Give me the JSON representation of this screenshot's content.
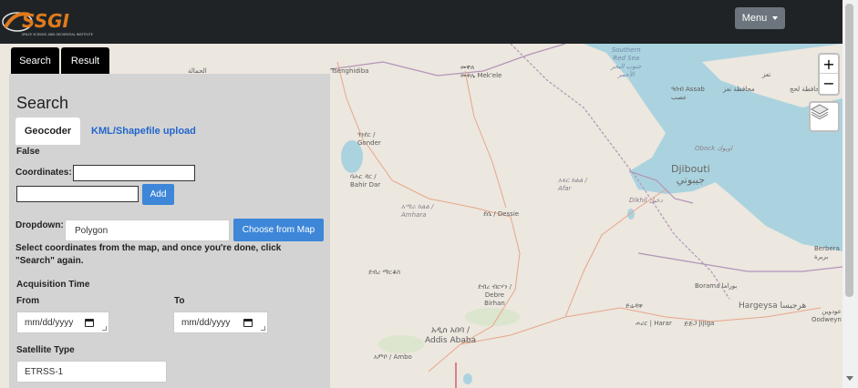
{
  "header": {
    "logo_text": "SSGI",
    "logo_tagline": "SPACE SCIENCE AND GEOSPATIAL INSTITUTE",
    "menu_label": "Menu"
  },
  "tabs": {
    "search": "Search",
    "result": "Result"
  },
  "panel": {
    "title": "Search",
    "subtabs": {
      "geocoder": "Geocoder",
      "kml": "KML/Shapefile upload"
    },
    "false_text": "False",
    "coordinates_label": "Coordinates:",
    "coordinates_value": "",
    "second_coordinate_value": "",
    "add_button": "Add",
    "dropdown_label": "Dropdown:",
    "dropdown_value": "Polygon",
    "choose_map_button": "Choose from Map",
    "hint_line1": "Select coordinates from the map, and once you're done, click",
    "hint_line2": "\"Search\" again.",
    "acquisition_label": "Acquisition Time",
    "from_label": "From",
    "to_label": "To",
    "from_placeholder": "mm/dd/yyyy",
    "to_placeholder": "mm/dd/yyyy",
    "satellite_label": "Satellite Type",
    "satellite_value": "ETRSS-1"
  },
  "map": {
    "zoom_in": "+",
    "zoom_out": "−",
    "labels": {
      "southern_red_sea": "Southern\nRed Sea\nجنوب البحر\nالأحمر",
      "tenghidiba": "Tsenghidiba",
      "mekele": "መቐለ\nመቀሌ Mek'ele",
      "assab": "ዓሰብ Assab\nعصب",
      "assab_gov": "محافظة تعز",
      "lahj": "محافظة لحج",
      "taiz": "تعز",
      "gonder": "ጎንደር /\nGonder",
      "bahir_dar": "ባሕር ዳር /\nBahir Dar",
      "amhara": "አማራ ክልል /\nAmhara",
      "dessie": "ደሴ / Dessie",
      "afar": "አፋር ክልል /\nAfar",
      "obock": "Obock اوبوك",
      "djibouti": "Djibouti\nجيبوتي",
      "dikhil": "Dikhil دخيل",
      "berbera": "Berbera\nبربرة",
      "debre_markos": "ደብረ ማርቆስ",
      "debre_birhan": "ደብረ ብርሃን /\nDebre\nBirhan",
      "borama": "Borama بوراما",
      "hargeysa": "Hargeysa هرجيسا",
      "oodweyne": "عودوين\nOodweyn",
      "dire_dawa": "ድሬዳዋ",
      "harar": "ሐረር | Harar",
      "jijiga": "ጅጅጋ Jijiga",
      "addis": "አዲስ አበባ /\nAddis Ababa",
      "ambo": "አምቦ / Ambo",
      "left_town1": "الحمالة",
      "left_town2": "قلابات"
    }
  },
  "colors": {
    "navbar": "#1f2326",
    "panel": "#d3d3d3",
    "accent_blue": "#3d86d8",
    "link_blue": "#2266cc",
    "water": "#abd3df",
    "land": "#ece7df"
  }
}
